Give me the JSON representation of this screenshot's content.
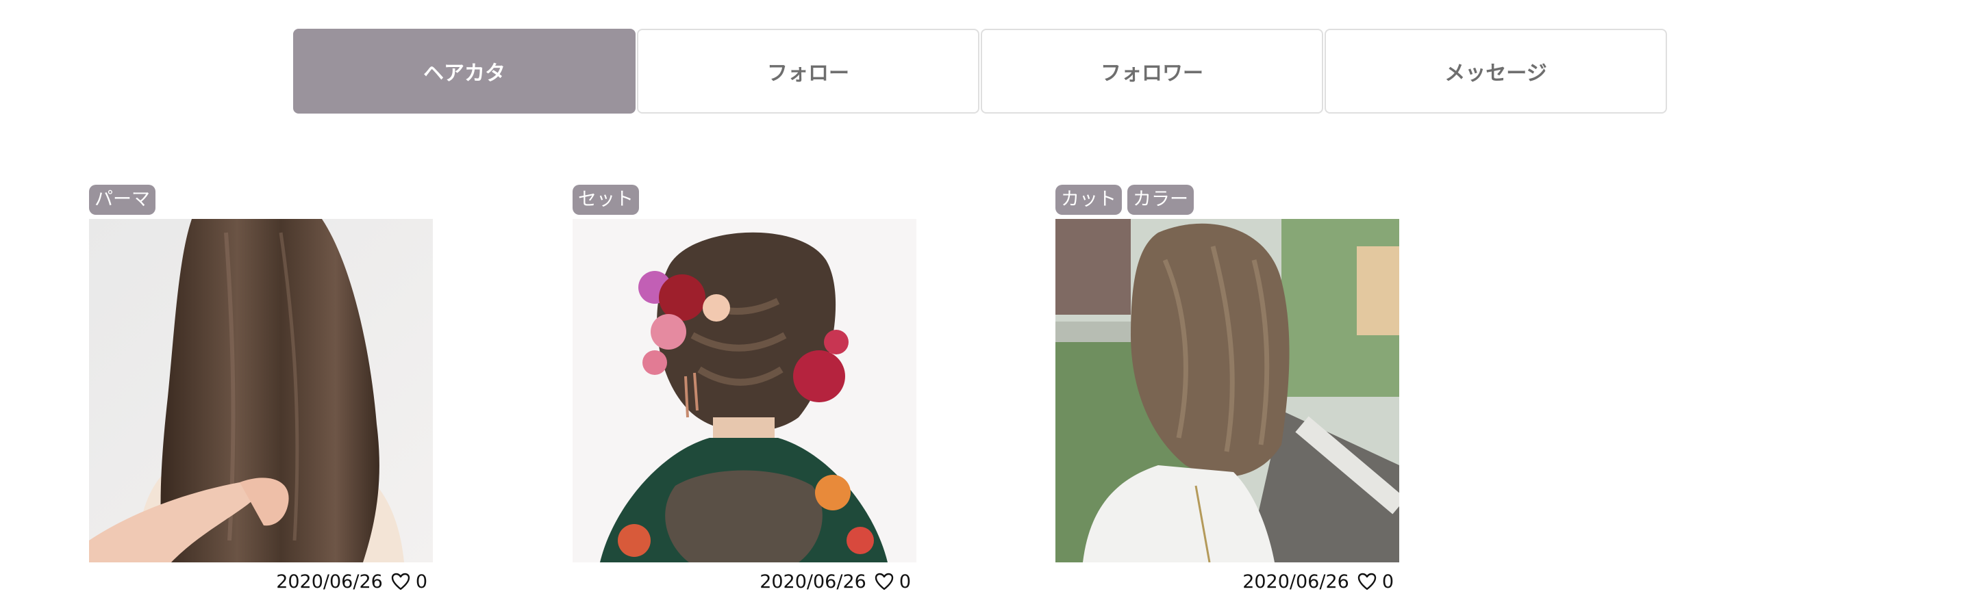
{
  "tabs": [
    {
      "label": "ヘアカタ",
      "active": true
    },
    {
      "label": "フォロー",
      "active": false
    },
    {
      "label": "フォロワー",
      "active": false
    },
    {
      "label": "メッセージ",
      "active": false
    }
  ],
  "colors": {
    "accent": "#9a939c",
    "tab_border": "#dfdfdf",
    "tab_text": "#6e6e6e"
  },
  "cards": [
    {
      "tags": [
        "パーマ"
      ],
      "date": "2020/06/26",
      "likes": "0",
      "icon": "heart-outline-icon"
    },
    {
      "tags": [
        "セット"
      ],
      "date": "2020/06/26",
      "likes": "0",
      "icon": "heart-outline-icon"
    },
    {
      "tags": [
        "カット",
        "カラー"
      ],
      "date": "2020/06/26",
      "likes": "0",
      "icon": "heart-outline-icon"
    }
  ]
}
